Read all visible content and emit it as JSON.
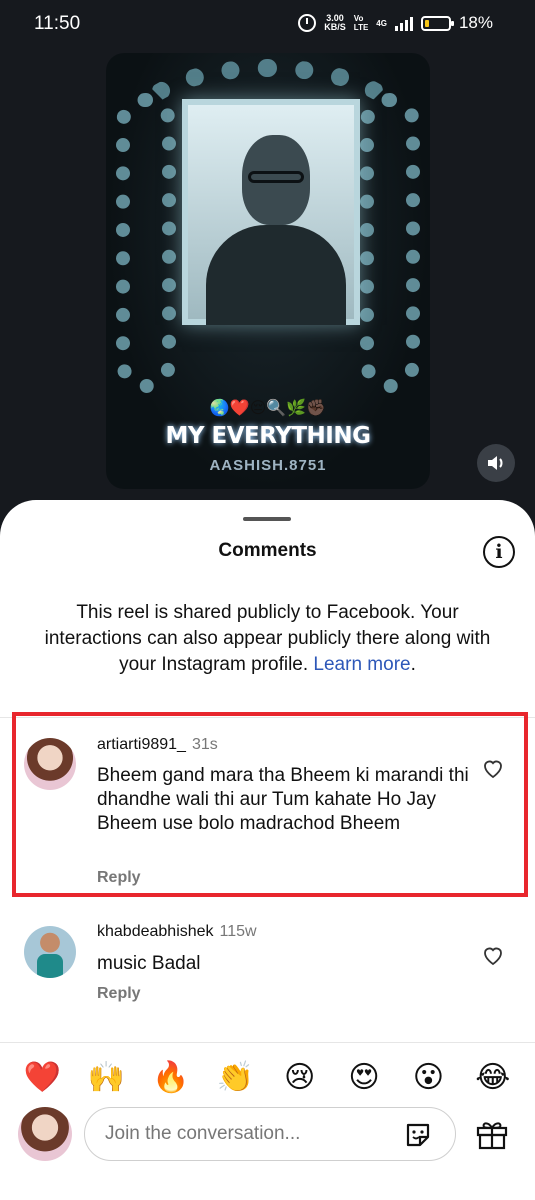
{
  "status_bar": {
    "time": "11:50",
    "network_speed": "3.00",
    "network_unit": "KB/S",
    "lte_label_1": "Vo",
    "lte_label_2": "LTE",
    "signal_label": "4G",
    "battery_percent": "18%",
    "battery_level": 0.18,
    "icons": [
      "alarm-icon",
      "signal-icon",
      "battery-icon"
    ]
  },
  "video": {
    "emoji_line": "🌏❤️😔🔍🌿✊🏿",
    "title": "MY EVERYTHING",
    "handle": "AASHISH.8751",
    "mute_icon": "volume-icon"
  },
  "comments_sheet": {
    "title": "Comments",
    "info_icon": "i",
    "notice_text": "This reel is shared publicly to Facebook. Your interactions can also appear publicly there along with your Instagram profile.",
    "notice_link": "Learn more",
    "notice_end": ".",
    "comments": [
      {
        "username": "artiarti9891_",
        "time": "31s",
        "text": "Bheem gand mara tha Bheem ki marandi thi dhandhe wali thi aur Tum kahate Ho Jay Bheem use bolo madrachod Bheem",
        "reply_label": "Reply"
      },
      {
        "username": "khabdeabhishek",
        "time": "115w",
        "text": "music Badal",
        "reply_label": "Reply"
      }
    ]
  },
  "reactions": [
    "❤️",
    "🙌",
    "🔥",
    "👏",
    "😢",
    "😍",
    "😮",
    "😂"
  ],
  "input": {
    "placeholder": "Join the conversation..."
  },
  "colors": {
    "background": "#16191e",
    "link": "#2d57b8",
    "highlight_border": "#e8262d"
  }
}
